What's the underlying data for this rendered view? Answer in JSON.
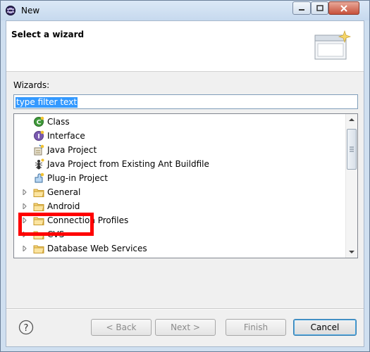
{
  "window": {
    "title": "New"
  },
  "banner": {
    "title": "Select a wizard"
  },
  "wizards": {
    "label": "Wizards:",
    "filter_value": "type filter text",
    "items": [
      {
        "label": "Class",
        "icon": "class-icon",
        "expandable": false
      },
      {
        "label": "Interface",
        "icon": "interface-icon",
        "expandable": false
      },
      {
        "label": "Java Project",
        "icon": "java-project-icon",
        "expandable": false
      },
      {
        "label": "Java Project from Existing Ant Buildfile",
        "icon": "ant-icon",
        "expandable": false
      },
      {
        "label": "Plug-in Project",
        "icon": "plugin-icon",
        "expandable": false
      },
      {
        "label": "General",
        "icon": "folder-icon",
        "expandable": true
      },
      {
        "label": "Android",
        "icon": "folder-icon",
        "expandable": true
      },
      {
        "label": "Connection Profiles",
        "icon": "folder-icon",
        "expandable": true
      },
      {
        "label": "CVS",
        "icon": "folder-icon",
        "expandable": true
      },
      {
        "label": "Database Web Services",
        "icon": "folder-icon",
        "expandable": true
      }
    ]
  },
  "buttons": {
    "back": "< Back",
    "next": "Next >",
    "finish": "Finish",
    "cancel": "Cancel"
  },
  "colors": {
    "highlight": "#ff0000",
    "selection": "#3399ff"
  }
}
